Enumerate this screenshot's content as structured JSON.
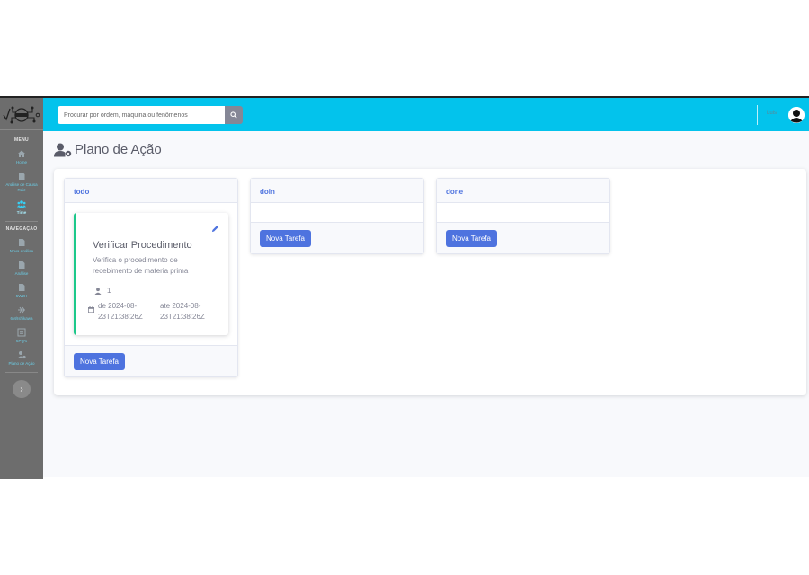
{
  "sidebar": {
    "menu_heading": "MENU",
    "nav_heading": "NAVEGAÇÃO",
    "items": [
      {
        "label": "Home"
      },
      {
        "label": "Análise de Causa Raiz"
      },
      {
        "label": "Time"
      },
      {
        "label": "Nova Análise"
      },
      {
        "label": "Análise"
      },
      {
        "label": "5W2H"
      },
      {
        "label": "6M/Ishikawa"
      },
      {
        "label": "5PQ's"
      },
      {
        "label": "Plano de Ação"
      }
    ],
    "toggle_icon": "chevron-right-icon"
  },
  "topbar": {
    "search_placeholder": "Procurar por ordem, máquina ou fenômenos",
    "search_icon": "search-icon",
    "user_name": "Luis",
    "avatar_icon": "user-circle-icon"
  },
  "page": {
    "title": "Plano de Ação",
    "title_icon": "user-cog-icon"
  },
  "board": {
    "columns": [
      {
        "title": "todo",
        "button": "Nova Tarefa",
        "tasks": [
          {
            "title": "Verificar Procedimento",
            "description": "Verifica o procedimento de recebimento de materia prima",
            "count": "1",
            "date_from": "de 2024-08-23T21:38:26Z",
            "date_to": "ate 2024-08-23T21:38:26Z"
          }
        ]
      },
      {
        "title": "doin",
        "button": "Nova Tarefa",
        "tasks": []
      },
      {
        "title": "done",
        "button": "Nova Tarefa",
        "tasks": []
      }
    ]
  },
  "colors": {
    "topbar": "#03c3ec",
    "sidebar": "#6d6d6d",
    "primary": "#4e73df",
    "success_border": "#1cc88a",
    "sidebar_link": "#6ccde6"
  }
}
